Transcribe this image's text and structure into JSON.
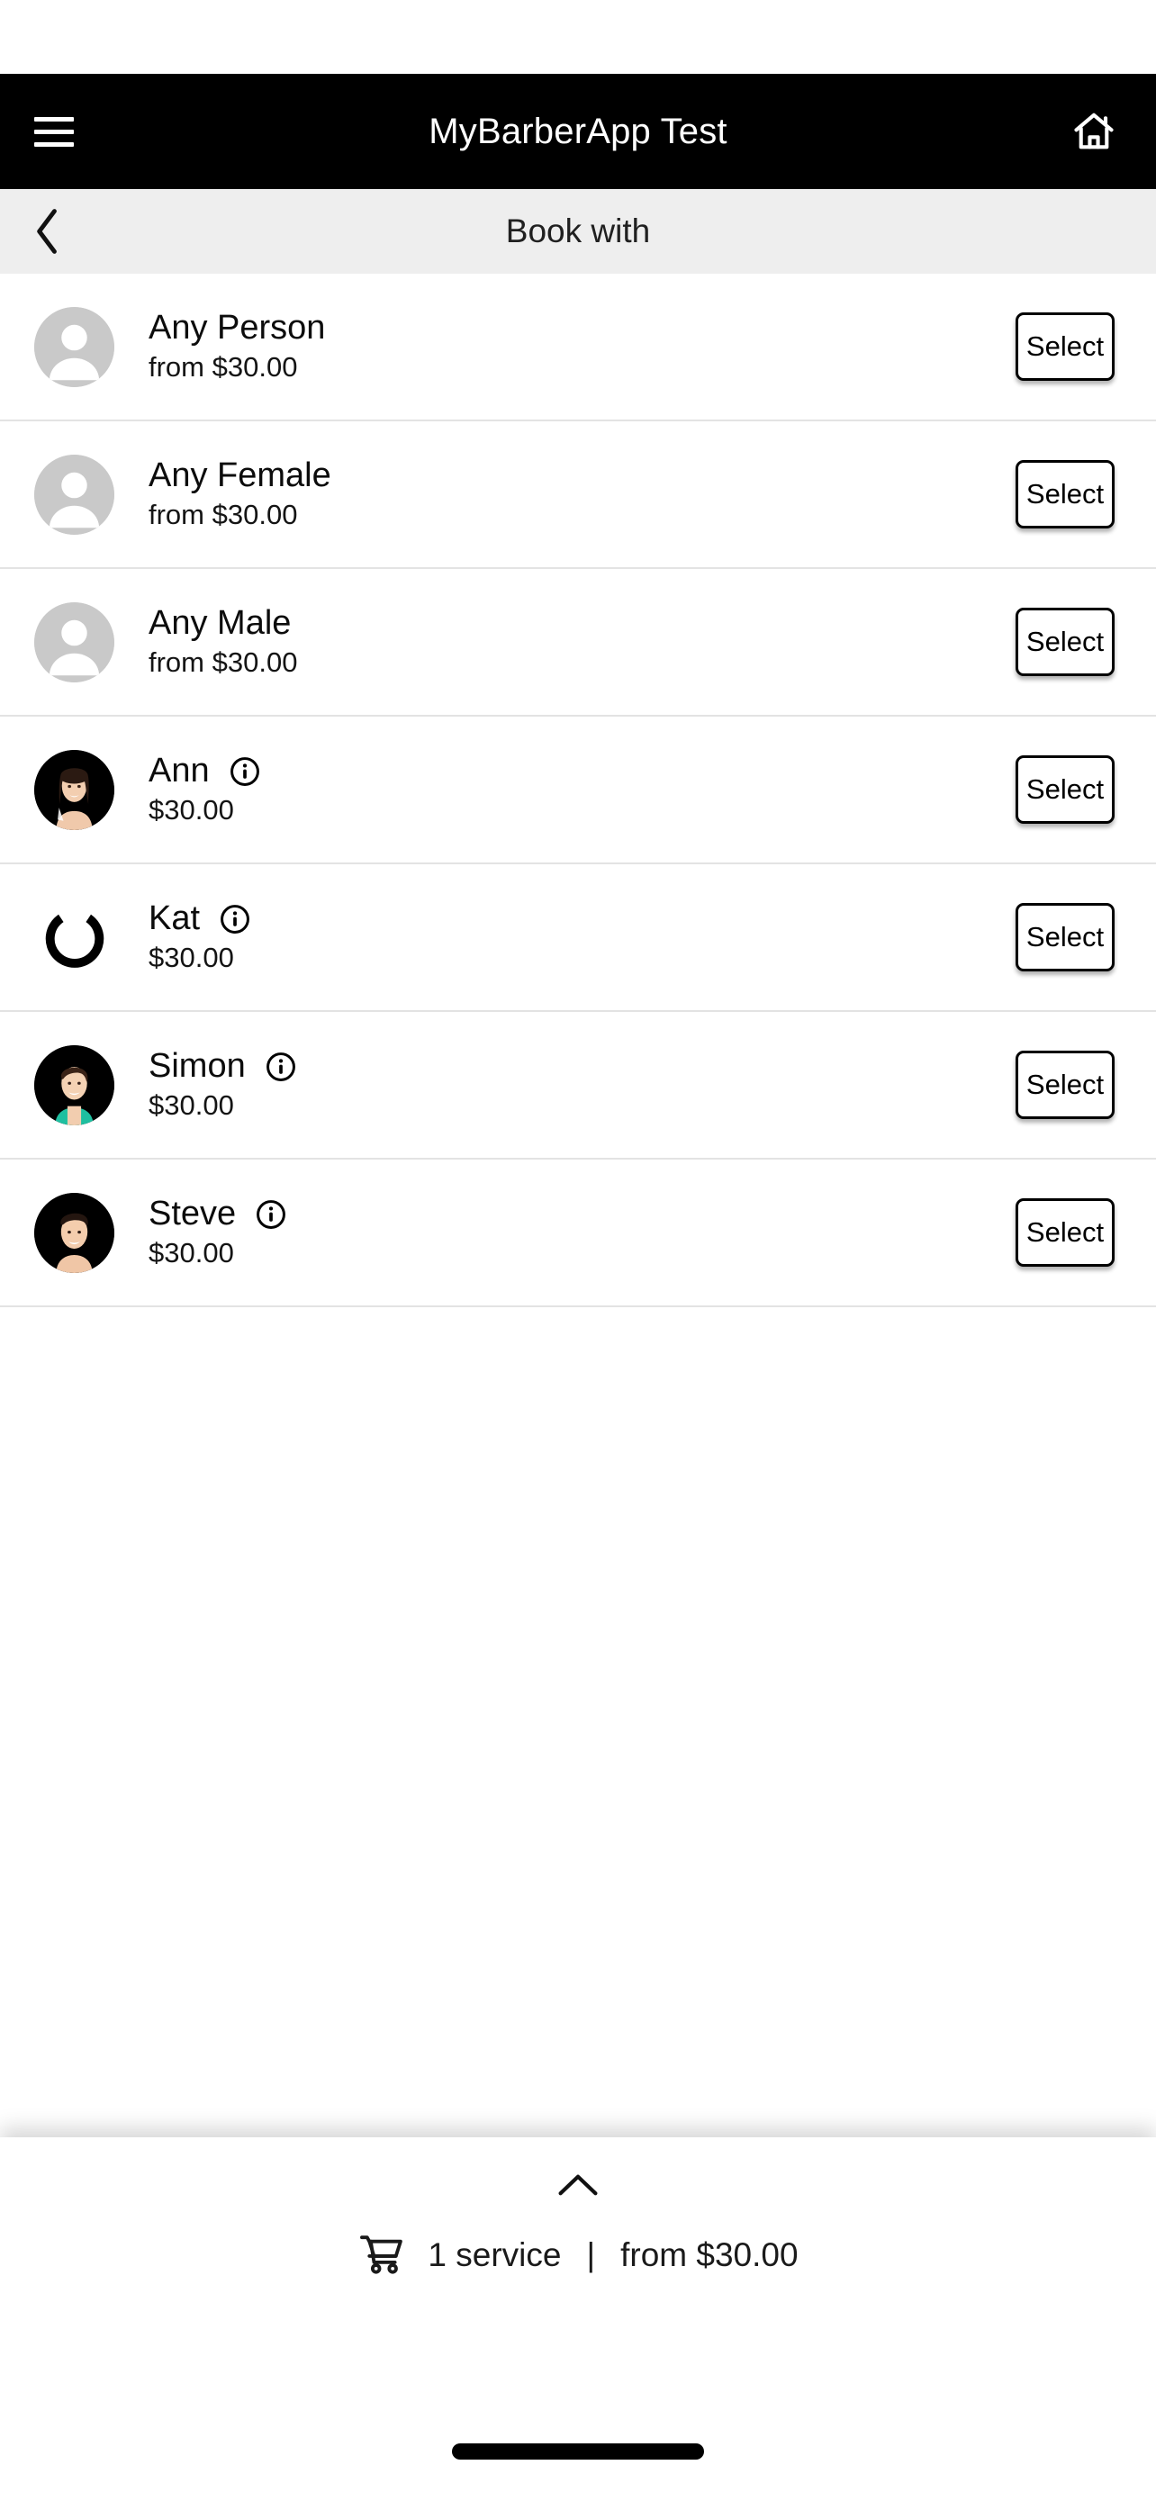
{
  "header": {
    "title": "MyBarberApp Test",
    "menu_icon": "hamburger-icon",
    "home_icon": "home-icon"
  },
  "sub_header": {
    "title": "Book with",
    "back_icon": "chevron-left-icon"
  },
  "list": {
    "select_label": "Select",
    "info_icon": "info-circle-icon",
    "items": [
      {
        "name": "Any Person",
        "price": "from $30.00",
        "avatar": "generic-person-avatar",
        "has_info": false,
        "select": "Select"
      },
      {
        "name": "Any Female",
        "price": "from $30.00",
        "avatar": "generic-person-avatar",
        "has_info": false,
        "select": "Select"
      },
      {
        "name": "Any Male",
        "price": "from $30.00",
        "avatar": "generic-person-avatar",
        "has_info": false,
        "select": "Select"
      },
      {
        "name": "Ann",
        "price": "$30.00",
        "avatar": "photo-ann",
        "has_info": true,
        "select": "Select"
      },
      {
        "name": "Kat",
        "price": "$30.00",
        "avatar": "loading-spinner",
        "has_info": true,
        "select": "Select"
      },
      {
        "name": "Simon",
        "price": "$30.00",
        "avatar": "photo-simon",
        "has_info": true,
        "select": "Select"
      },
      {
        "name": "Steve",
        "price": "$30.00",
        "avatar": "photo-steve",
        "has_info": true,
        "select": "Select"
      }
    ]
  },
  "cart_bar": {
    "expand_icon": "chevron-up-icon",
    "cart_icon": "shopping-cart-icon",
    "services_text": "1 service",
    "separator": "|",
    "total_text": "from $30.00"
  },
  "colors": {
    "header_bg": "#000000",
    "sub_header_bg": "#eeeeee",
    "page_bg": "#ffffff",
    "divider": "#e3e3e3",
    "avatar_gray": "#c9c9c9",
    "text": "#111111",
    "simon_shirt_teal": "#1fbfa0"
  }
}
